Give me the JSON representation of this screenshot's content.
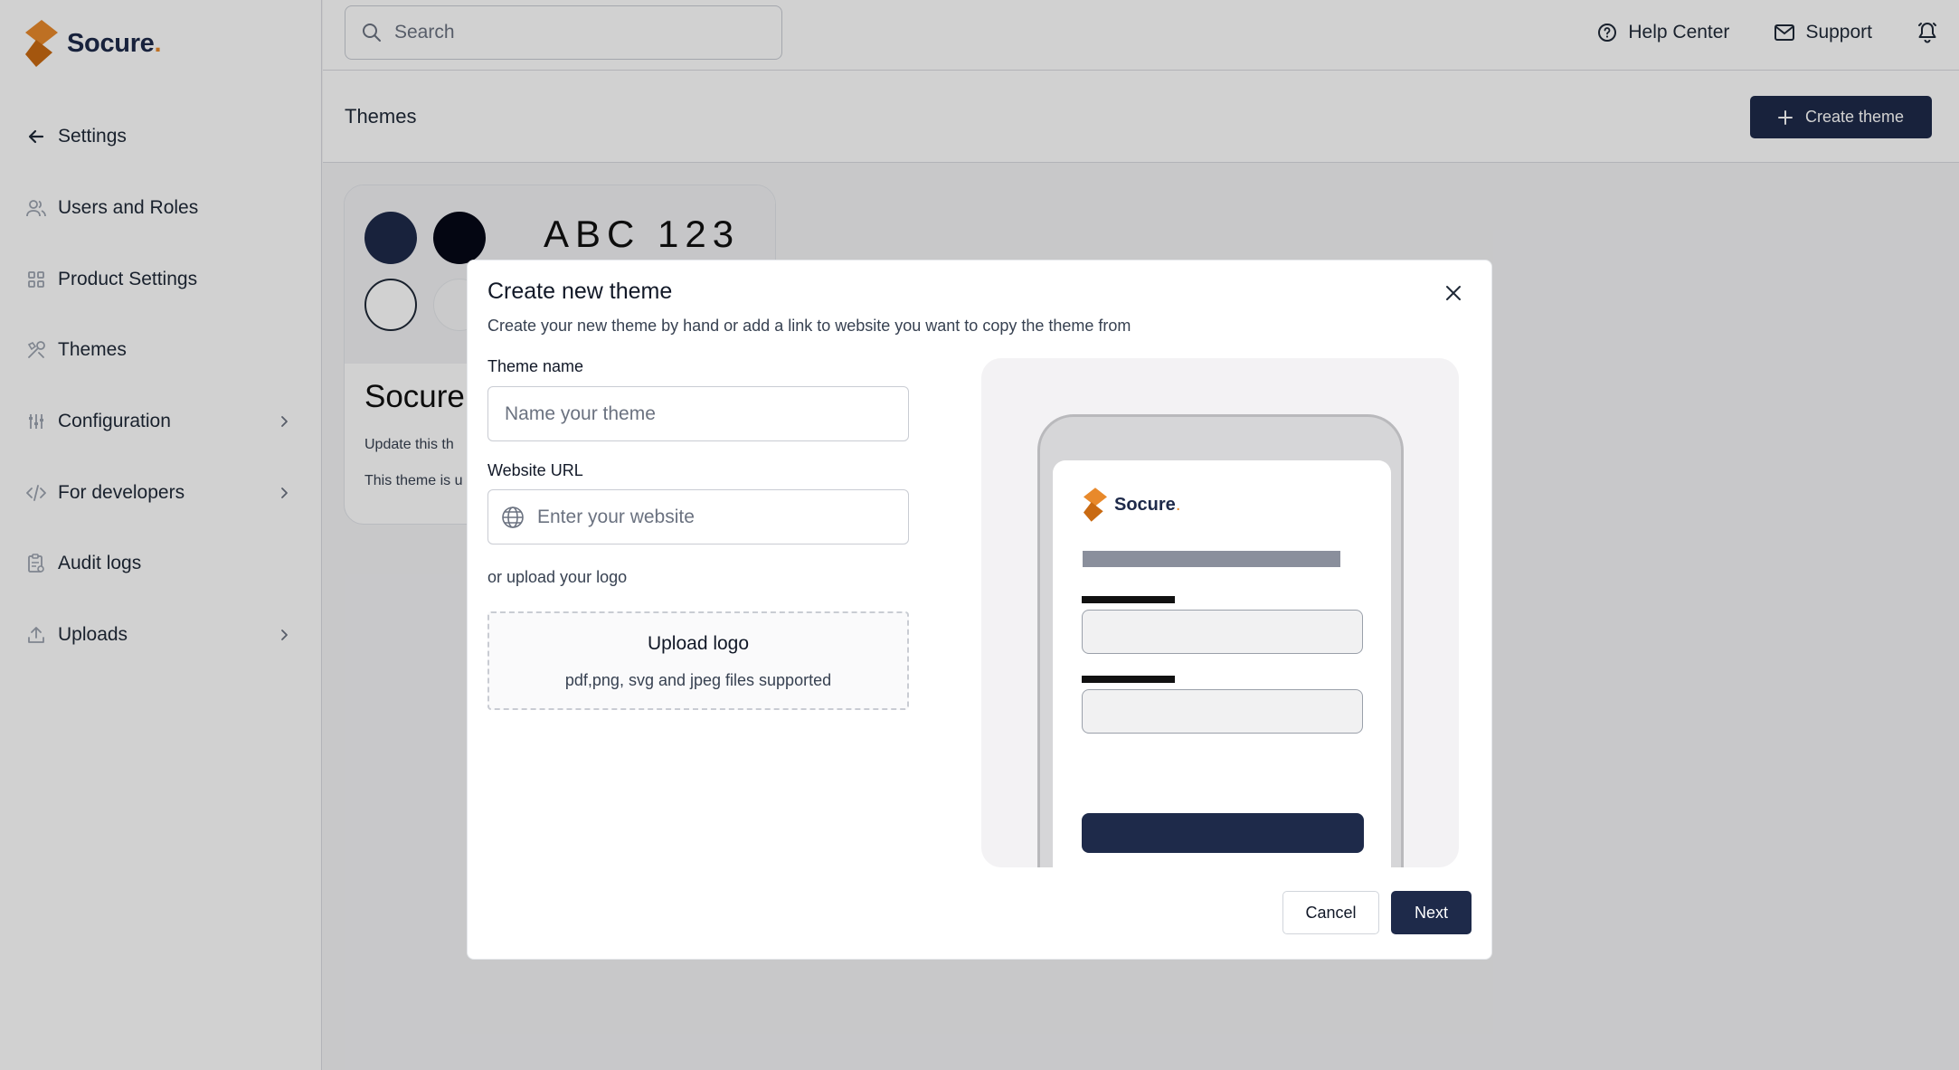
{
  "brand": {
    "name": "Socure",
    "dot": ".",
    "primary_color": "#1e2a4a",
    "accent_color": "#e8892b"
  },
  "sidebar": {
    "items": [
      {
        "label": "Settings",
        "icon": "arrow-left-icon"
      },
      {
        "label": "Users and Roles",
        "icon": "users-icon"
      },
      {
        "label": "Product Settings",
        "icon": "grid-icon"
      },
      {
        "label": "Themes",
        "icon": "palette-icon"
      },
      {
        "label": "Configuration",
        "icon": "sliders-icon",
        "has_chevron": true
      },
      {
        "label": "For developers",
        "icon": "code-icon",
        "has_chevron": true
      },
      {
        "label": "Audit logs",
        "icon": "clipboard-icon"
      },
      {
        "label": "Uploads",
        "icon": "upload-icon",
        "has_chevron": true
      }
    ]
  },
  "topbar": {
    "search_placeholder": "Search",
    "help_label": "Help Center",
    "support_label": "Support"
  },
  "page": {
    "title": "Themes",
    "create_button_label": "Create theme"
  },
  "theme_card": {
    "sample_text": "ABC 123",
    "name": "Socure",
    "description_1": "Update this th",
    "description_2": "This theme is u",
    "swatches": [
      "#1e2a4a",
      "#050816",
      "#ffffff",
      "#f2f2f4"
    ]
  },
  "modal": {
    "title": "Create new theme",
    "subtitle": "Create your new theme by hand or add a link to website you want to copy the theme from",
    "theme_name_label": "Theme name",
    "theme_name_placeholder": "Name your theme",
    "website_label": "Website URL",
    "website_placeholder": "Enter your website",
    "or_upload_text": "or upload your logo",
    "upload_title": "Upload logo",
    "upload_subtitle": "pdf,png, svg and jpeg files supported",
    "cancel_label": "Cancel",
    "next_label": "Next",
    "preview_logo_text": "Socure",
    "preview_logo_dot": "."
  }
}
